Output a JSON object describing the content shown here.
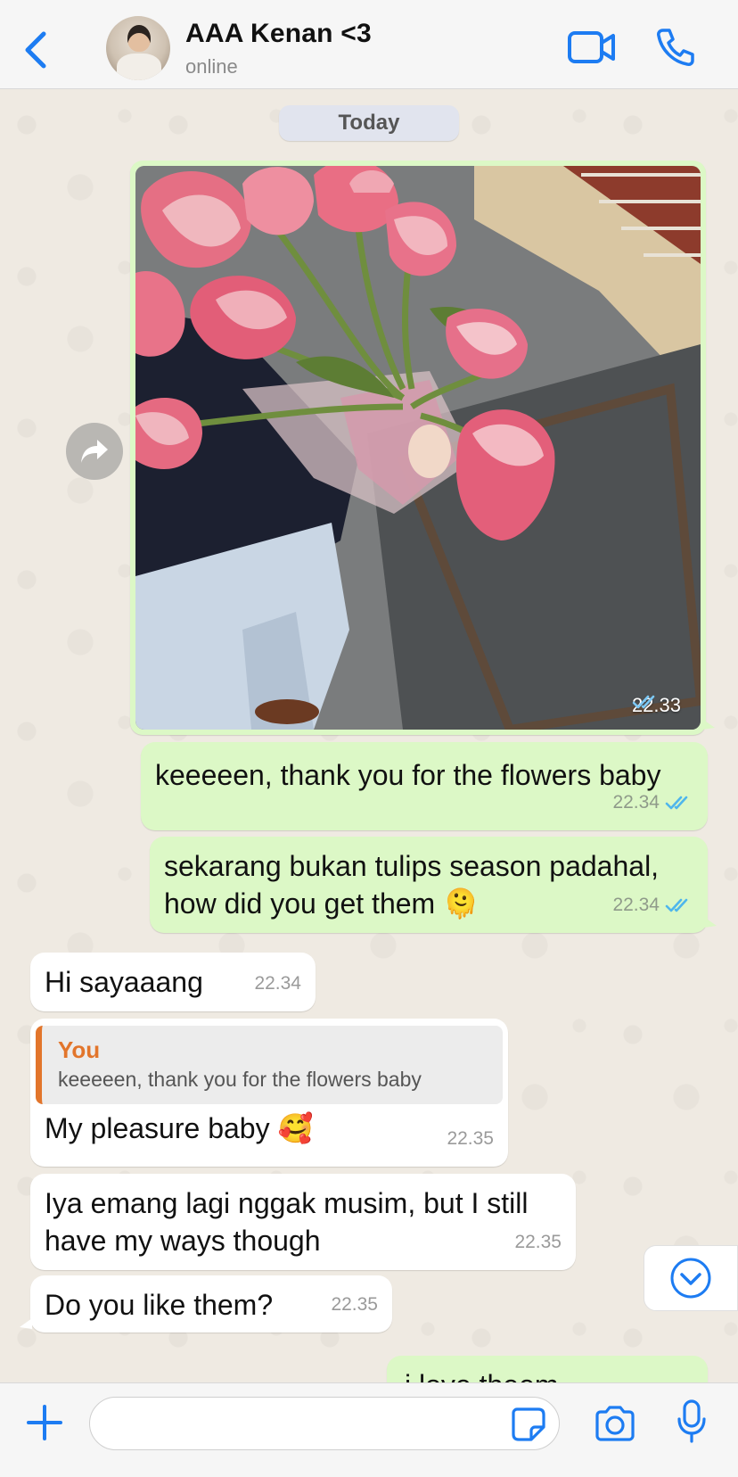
{
  "header": {
    "contact_name": "AAA Kenan <3",
    "status": "online",
    "icons": [
      "chevron-left-icon",
      "video-camera-icon",
      "phone-icon"
    ],
    "accent_color": "#1d7cf2"
  },
  "chat": {
    "date_label": "Today",
    "image_message": {
      "time": "22.33",
      "status": "read"
    },
    "messages": [
      {
        "direction": "out",
        "text": "keeeeen, thank you for the flowers baby",
        "time": "22.34",
        "status": "read"
      },
      {
        "direction": "out",
        "text": "sekarang bukan tulips season padahal, how did you get them 🫠",
        "time": "22.34",
        "status": "read"
      },
      {
        "direction": "in",
        "text": "Hi sayaaang",
        "time": "22.34"
      },
      {
        "direction": "in",
        "reply_to": {
          "author": "You",
          "text": "keeeeen, thank you for the flowers baby"
        },
        "text": "My pleasure baby 🥰",
        "time": "22.35"
      },
      {
        "direction": "in",
        "text": "Iya emang lagi nggak musim, but I still have my ways though",
        "time": "22.35"
      },
      {
        "direction": "in",
        "text": "Do you like them?",
        "time": "22.35"
      },
      {
        "direction": "out",
        "text": "i love theem",
        "time": ""
      }
    ]
  },
  "composer": {
    "placeholder": "",
    "icons": [
      "plus-icon",
      "sticker-icon",
      "camera-icon",
      "microphone-icon"
    ]
  },
  "colors": {
    "outgoing_bubble": "#dcf8c6",
    "incoming_bubble": "#ffffff",
    "read_ticks": "#4fb6ec",
    "quote_author": "#e2752b",
    "chat_background": "#efeae2"
  }
}
